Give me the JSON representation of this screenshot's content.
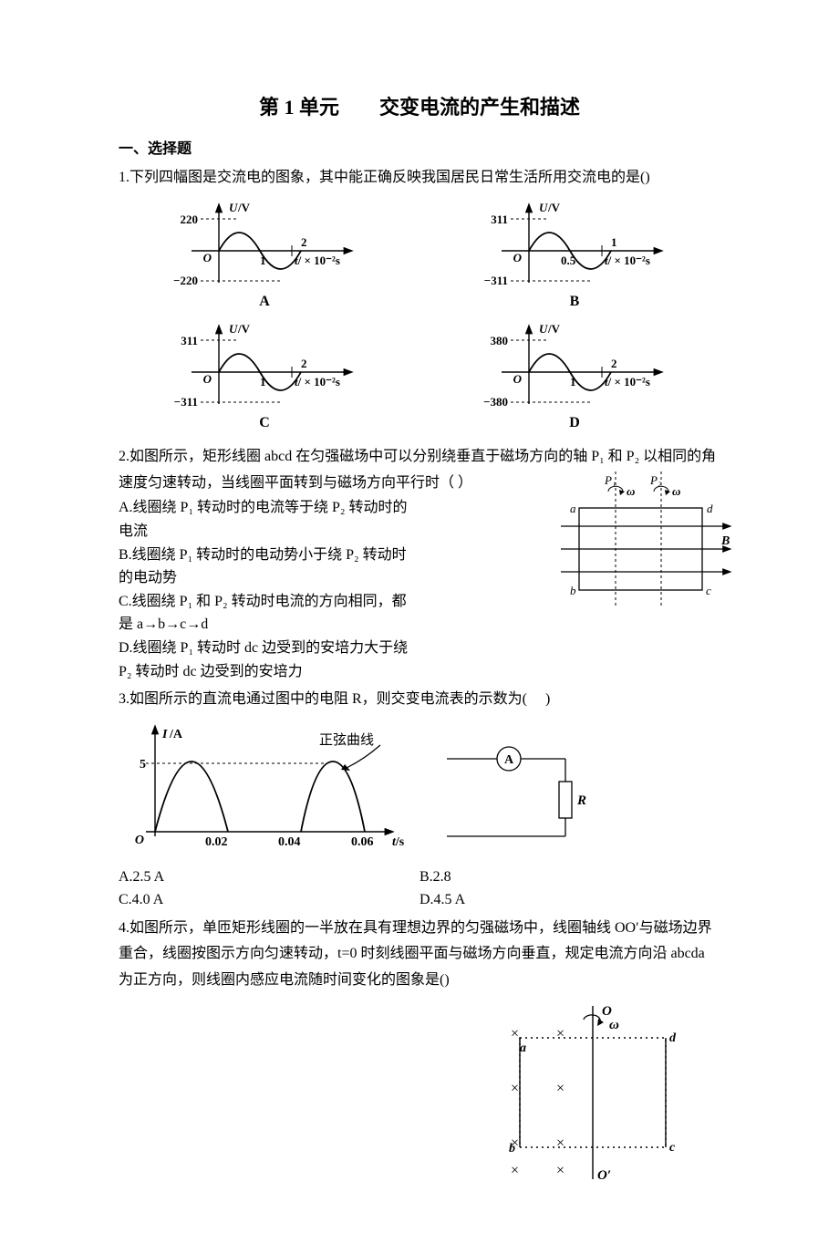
{
  "title": "第 1 单元　　交变电流的产生和描述",
  "section1": "一、选择题",
  "q1": {
    "text": "1.下列四幅图是交流电的图象，其中能正确反映我国居民日常生活所用交流电的是()",
    "labels": {
      "A": "A",
      "B": "B",
      "C": "C",
      "D": "D"
    }
  },
  "chart_data": [
    {
      "type": "line",
      "label": "A",
      "ylabel": "U/V",
      "xlabel": "t/ × 10⁻²s",
      "ylim": [
        -220,
        220
      ],
      "xvals": [
        "1",
        "2"
      ],
      "peak": 220,
      "period": 2,
      "shape": "sine"
    },
    {
      "type": "line",
      "label": "B",
      "ylabel": "U/V",
      "xlabel": "t/ × 10⁻²s",
      "ylim": [
        -311,
        311
      ],
      "xvals": [
        "0.5",
        "1"
      ],
      "peak": 311,
      "period": 1,
      "shape": "sine"
    },
    {
      "type": "line",
      "label": "C",
      "ylabel": "U/V",
      "xlabel": "t/ × 10⁻²s",
      "ylim": [
        -311,
        311
      ],
      "xvals": [
        "1",
        "2"
      ],
      "peak": 311,
      "period": 2,
      "shape": "sine"
    },
    {
      "type": "line",
      "label": "D",
      "ylabel": "U/V",
      "xlabel": "t/ × 10⁻²s",
      "ylim": [
        -380,
        380
      ],
      "xvals": [
        "1",
        "2"
      ],
      "peak": 380,
      "period": 2,
      "shape": "sine"
    }
  ],
  "q2": {
    "text": "2.如图所示，矩形线圈 abcd 在匀强磁场中可以分别绕垂直于磁场方向的轴 P₁ 和 P₂ 以相同的角速度匀速转动，当线圈平面转到与磁场方向平行时（  ）",
    "A": "A.线圈绕 P₁ 转动时的电流等于绕 P₂ 转动时的电流",
    "B": "B.线圈绕 P₁ 转动时的电动势小于绕 P₂ 转动时的电动势",
    "C": "C.线圈绕 P₁ 和 P₂ 转动时电流的方向相同，都是 a→b→c→d",
    "D": "D.线圈绕 P₁ 转动时 dc 边受到的安培力大于绕 P₂ 转动时 dc 边受到的安培力",
    "figure": {
      "P1": "P₁",
      "P2": "P₂",
      "omega": "ω",
      "a": "a",
      "b": "b",
      "c": "c",
      "d": "d",
      "B": "B"
    }
  },
  "q3": {
    "text": "3.如图所示的直流电通过图中的电阻 R，则交变电流表的示数为(　 )",
    "A": "A.2.5 A",
    "B": "B.2.8",
    "C": "C.4.0 A",
    "D": "D.4.5 A",
    "graph": {
      "ylabel": "I/A",
      "xlabel": "t/s",
      "ypeak": 5,
      "xvals": [
        "0.02",
        "0.04",
        "0.06"
      ],
      "curve_label": "正弦曲线",
      "circuit_A": "A",
      "circuit_R": "R"
    }
  },
  "q4": {
    "text": "4.如图所示，单匝矩形线圈的一半放在具有理想边界的匀强磁场中，线圈轴线 OO′与磁场边界重合，线圈按图示方向匀速转动，t=0 时刻线圈平面与磁场方向垂直，规定电流方向沿 abcda 为正方向，则线圈内感应电流随时间变化的图象是()",
    "figure": {
      "O": "O",
      "Oprime": "O′",
      "omega": "ω",
      "a": "a",
      "b": "b",
      "c": "c",
      "d": "d"
    }
  }
}
